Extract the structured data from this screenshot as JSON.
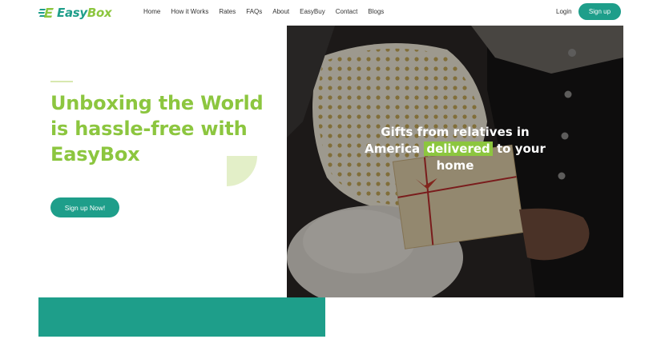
{
  "brand": {
    "name_part1": "Easy",
    "name_part2": "Box"
  },
  "nav": {
    "items": [
      "Home",
      "How it Works",
      "Rates",
      "FAQs",
      "About",
      "EasyBuy",
      "Contact",
      "Blogs"
    ]
  },
  "header": {
    "login_label": "Login",
    "signup_label": "Sign up"
  },
  "hero": {
    "title": "Unboxing the World is hassle-free with EasyBox",
    "cta_label": "Sign up Now!",
    "caption_before": "Gifts from relatives in America",
    "caption_highlight": "delivered",
    "caption_after": "to your home"
  },
  "colors": {
    "brand_green": "#8cc63f",
    "brand_teal": "#1e9e8a"
  },
  "icons": {
    "logo": "easybox-logo-icon"
  }
}
